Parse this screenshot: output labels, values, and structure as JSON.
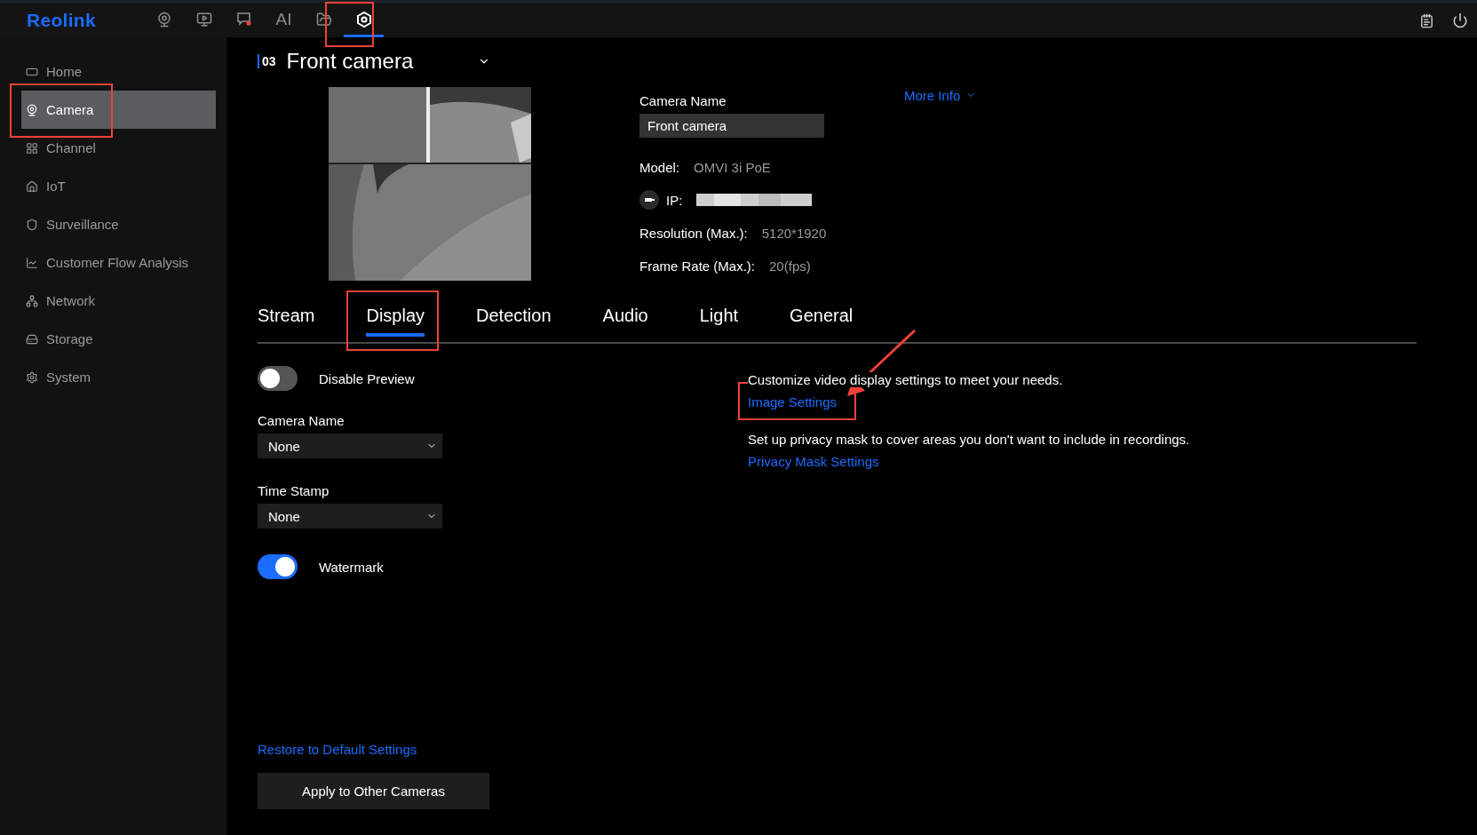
{
  "top_bar": {
    "logo": "Reolink",
    "nav": [
      {
        "kind": "camera",
        "selected": false
      },
      {
        "kind": "playback",
        "selected": false
      },
      {
        "kind": "alerts",
        "selected": false
      },
      {
        "kind": "text",
        "label": "AI",
        "selected": false
      },
      {
        "kind": "files",
        "selected": false
      },
      {
        "kind": "settings",
        "selected": true
      }
    ]
  },
  "sidebar": {
    "items": [
      {
        "label": "Home",
        "selected": false
      },
      {
        "label": "Camera",
        "selected": true
      },
      {
        "label": "Channel",
        "selected": false
      },
      {
        "label": "IoT",
        "selected": false
      },
      {
        "label": "Surveillance",
        "selected": false
      },
      {
        "label": "Customer Flow Analysis",
        "selected": false
      },
      {
        "label": "Network",
        "selected": false
      },
      {
        "label": "Storage",
        "selected": false
      },
      {
        "label": "System",
        "selected": false
      }
    ]
  },
  "camera": {
    "number": "03",
    "name": "Front camera"
  },
  "info": {
    "name_label": "Camera Name",
    "name_value": "Front camera",
    "more_info": "More Info",
    "rows": [
      {
        "kind": "plain",
        "label": "Model:",
        "value": "OMVI 3i PoE"
      },
      {
        "kind": "ip",
        "label": "IP:"
      },
      {
        "kind": "plain",
        "label": "Resolution (Max.):",
        "value": "5120*1920"
      },
      {
        "kind": "plain",
        "label": "Frame Rate (Max.):",
        "value": "20(fps)"
      }
    ]
  },
  "tabs": [
    {
      "label": "Stream",
      "selected": false
    },
    {
      "label": "Display",
      "selected": true
    },
    {
      "label": "Detection",
      "selected": false
    },
    {
      "label": "Audio",
      "selected": false
    },
    {
      "label": "Light",
      "selected": false
    },
    {
      "label": "General",
      "selected": false
    }
  ],
  "settings": [
    {
      "kind": "toggle",
      "label": "Disable Preview",
      "on": false
    },
    {
      "kind": "select",
      "label": "Camera Name",
      "value": "None"
    },
    {
      "kind": "select",
      "label": "Time Stamp",
      "value": "None"
    },
    {
      "kind": "toggle",
      "label": "Watermark",
      "on": true
    }
  ],
  "help": [
    {
      "text": "Customize video display settings to meet your needs.",
      "link": "Image Settings"
    },
    {
      "text": "Set up privacy mask to cover areas you don't want to include in recordings.",
      "link": "Privacy Mask Settings"
    }
  ],
  "restore_link": "Restore to Default Settings",
  "apply_button": "Apply to Other Cameras"
}
